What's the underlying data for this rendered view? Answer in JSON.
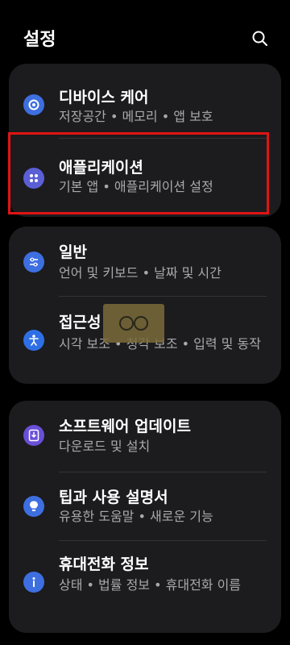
{
  "header": {
    "title": "설정",
    "search_icon": "search-icon"
  },
  "cards": [
    {
      "items": [
        {
          "title": "디바이스 케어",
          "subtitle": "저장공간 • 메모리 • 앱 보호",
          "icon": "device-care-icon",
          "icon_color": "#3e6fe0"
        },
        {
          "title": "애플리케이션",
          "subtitle": "기본 앱 • 애플리케이션 설정",
          "icon": "apps-icon",
          "icon_color": "#5b5fd6"
        }
      ]
    },
    {
      "items": [
        {
          "title": "일반",
          "subtitle": "언어 및 키보드 • 날짜 및 시간",
          "icon": "general-management-icon",
          "icon_color": "#3e6fe0"
        },
        {
          "title": "접근성",
          "subtitle": "시각 보조 • 청각 보조 • 입력 및 동작",
          "icon": "accessibility-icon",
          "icon_color": "#2f6fe6"
        }
      ]
    },
    {
      "items": [
        {
          "title": "소프트웨어 업데이트",
          "subtitle": "다운로드 및 설치",
          "icon": "software-update-icon",
          "icon_color": "#6a4fd8"
        },
        {
          "title": "팁과 사용 설명서",
          "subtitle": "유용한 도움말 • 새로운 기능",
          "icon": "tips-icon",
          "icon_color": "#3e6fe0"
        },
        {
          "title": "휴대전화 정보",
          "subtitle": "상태 • 법률 정보 • 휴대전화 이름",
          "icon": "info-icon",
          "icon_color": "#3e6fe0"
        }
      ]
    }
  ],
  "colors": {
    "background": "#000000",
    "card": "#1c1c1e",
    "subtitle": "#a9a9ad",
    "highlight": "#e11414"
  }
}
